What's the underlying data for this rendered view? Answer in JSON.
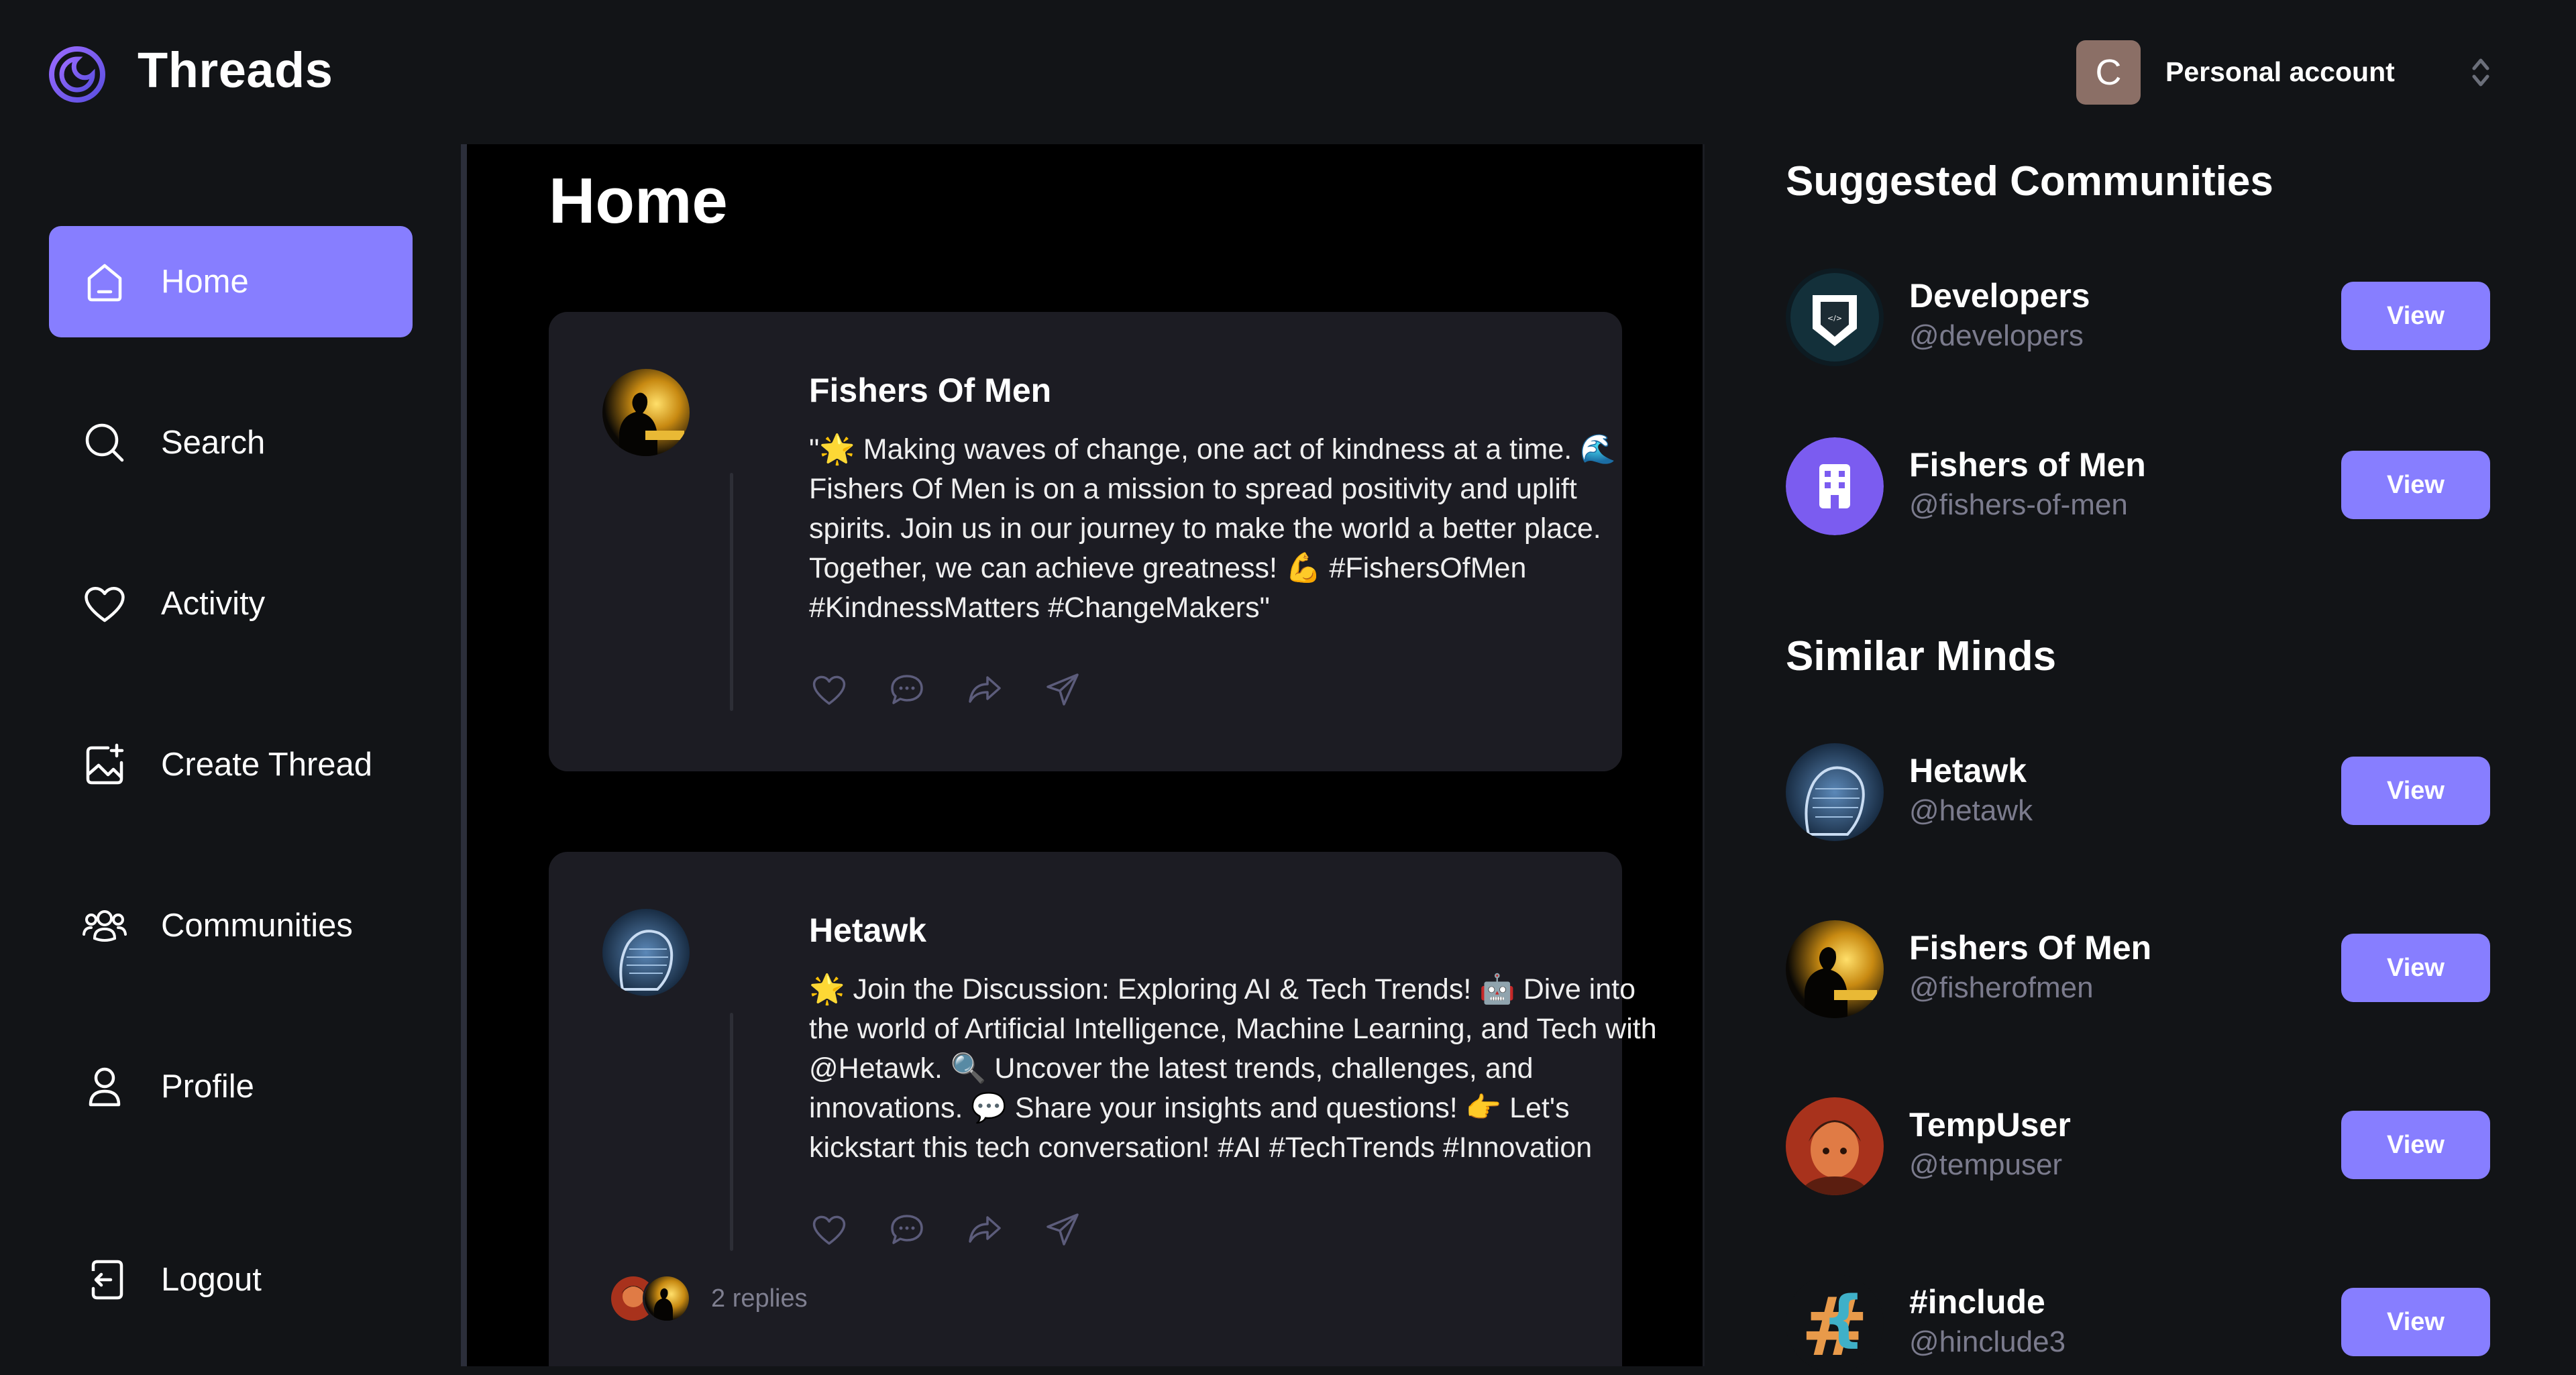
{
  "app": {
    "title": "Threads",
    "account_initial": "C",
    "account_label": "Personal account",
    "accent_color": "#877eff"
  },
  "sidebar": {
    "items": [
      {
        "label": "Home",
        "icon": "home-icon",
        "active": true
      },
      {
        "label": "Search",
        "icon": "search-icon",
        "active": false
      },
      {
        "label": "Activity",
        "icon": "heart-icon",
        "active": false
      },
      {
        "label": "Create Thread",
        "icon": "image-plus-icon",
        "active": false
      },
      {
        "label": "Communities",
        "icon": "users-icon",
        "active": false
      },
      {
        "label": "Profile",
        "icon": "user-icon",
        "active": false
      }
    ],
    "logout": {
      "label": "Logout",
      "icon": "logout-icon"
    }
  },
  "main": {
    "title": "Home",
    "posts": [
      {
        "author": "Fishers Of Men",
        "text": "\"🌟 Making waves of change, one act of kindness at a time. 🌊 Fishers Of Men is on a mission to spread positivity and uplift spirits. Join us in our journey to make the world a better place. Together, we can achieve greatness! 💪 #FishersOfMen #KindnessMatters #ChangeMakers\""
      },
      {
        "author": "Hetawk",
        "text": "🌟 Join the Discussion: Exploring AI & Tech Trends! 🤖 Dive into the world of Artificial Intelligence, Machine Learning, and Tech with @Hetawk. 🔍 Uncover the latest trends, challenges, and innovations. 💬 Share your insights and questions! 👉 Let's kickstart this tech conversation! #AI #TechTrends #Innovation",
        "replies": "2 replies"
      }
    ]
  },
  "rightbar": {
    "suggested_title": "Suggested Communities",
    "communities": [
      {
        "name": "Developers",
        "handle": "@developers",
        "button": "View"
      },
      {
        "name": "Fishers of Men",
        "handle": "@fishers-of-men",
        "button": "View"
      }
    ],
    "similar_title": "Similar Minds",
    "users": [
      {
        "name": "Hetawk",
        "handle": "@hetawk",
        "button": "View"
      },
      {
        "name": "Fishers Of Men",
        "handle": "@fisherofmen",
        "button": "View"
      },
      {
        "name": "TempUser",
        "handle": "@tempuser",
        "button": "View"
      },
      {
        "name": "#include",
        "handle": "@hinclude3",
        "button": "View"
      }
    ]
  }
}
